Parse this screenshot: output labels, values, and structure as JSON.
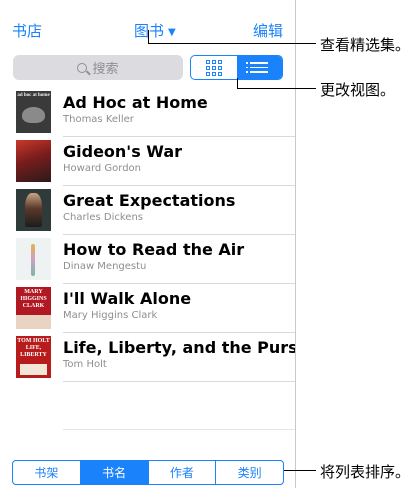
{
  "navbar": {
    "left": "书店",
    "title": "图书",
    "right": "编辑"
  },
  "search": {
    "placeholder": "搜索"
  },
  "books": [
    {
      "title": "Ad Hoc at Home",
      "author": "Thomas Keller",
      "cover_color": "#3a3a3a",
      "cover_text": "ad hoc at home"
    },
    {
      "title": "Gideon's War",
      "author": "Howard Gordon",
      "cover_color": "#7a1c1c",
      "cover_text": ""
    },
    {
      "title": "Great Expectations",
      "author": "Charles Dickens",
      "cover_color": "#2f3a3a",
      "cover_text": ""
    },
    {
      "title": "How to Read the Air",
      "author": "Dinaw Mengestu",
      "cover_color": "#e9eef0",
      "cover_text": ""
    },
    {
      "title": "I'll Walk Alone",
      "author": "Mary Higgins Clark",
      "cover_color": "#b01822",
      "cover_text": "MARY HIGGINS CLARK"
    },
    {
      "title": "Life, Liberty, and the Purs…",
      "author": "Tom Holt",
      "cover_color": "#b81b1b",
      "cover_text": "TOM HOLT LIFE, LIBERTY"
    }
  ],
  "sort_segments": [
    {
      "label": "书架",
      "selected": false
    },
    {
      "label": "书名",
      "selected": true
    },
    {
      "label": "作者",
      "selected": false
    },
    {
      "label": "类别",
      "selected": false
    }
  ],
  "callouts": {
    "collections": "查看精选集。",
    "change_view": "更改视图。",
    "sort_list": "将列表排序。"
  },
  "colors": {
    "accent": "#1a82fb"
  },
  "icons": {
    "view_grid": "grid-icon",
    "view_list": "list-icon",
    "search": "search-icon",
    "title_caret": "chevron-down-icon"
  }
}
